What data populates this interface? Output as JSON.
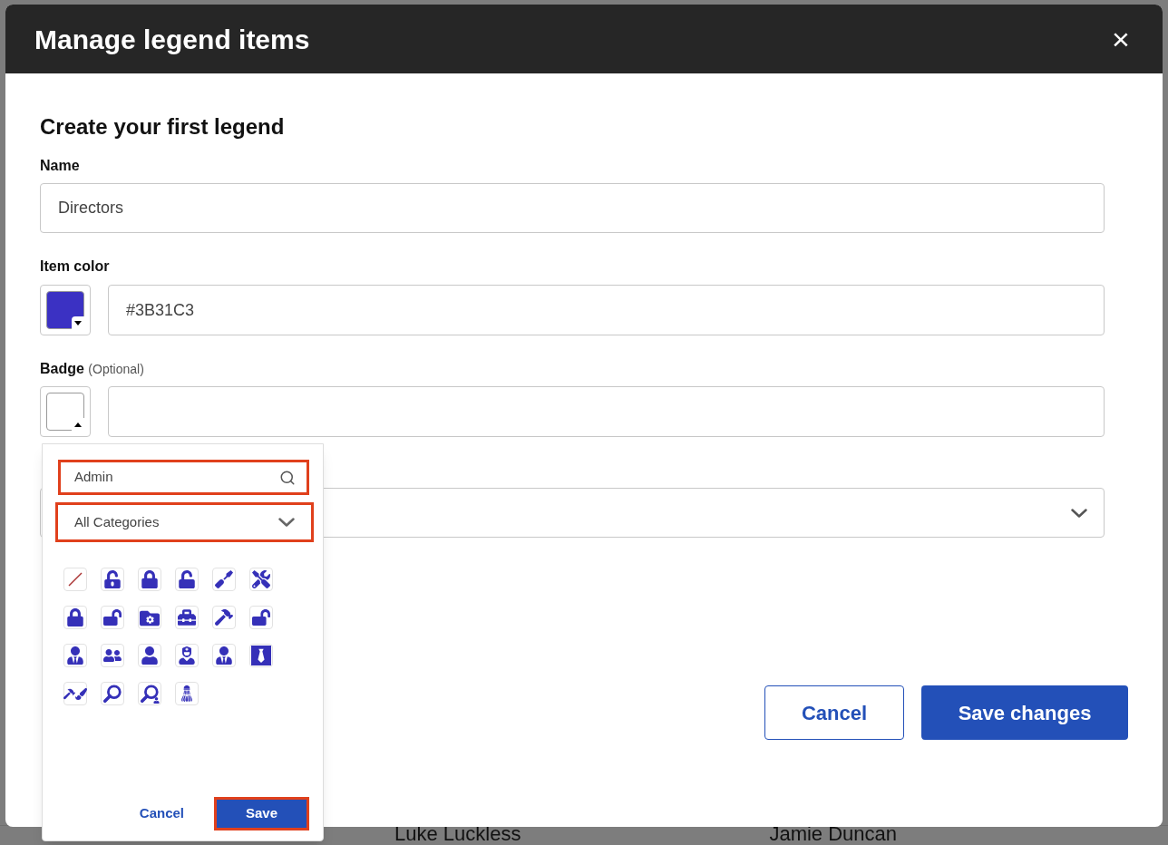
{
  "background": {
    "names": [
      "Luke Luckless",
      "Jamie Duncan"
    ]
  },
  "dialog": {
    "title": "Manage legend items",
    "close": "×"
  },
  "form": {
    "heading": "Create your first legend",
    "name": {
      "label": "Name",
      "value": "Directors"
    },
    "item_color": {
      "label": "Item color",
      "value": "#3B31C3",
      "picker_expanded": false
    },
    "badge": {
      "label": "Badge",
      "hint": "(Optional)",
      "picker_expanded": true
    }
  },
  "badge_picker": {
    "search": {
      "value": "Admin"
    },
    "category": {
      "value": "All Categories"
    },
    "cancel": "Cancel",
    "save": "Save"
  },
  "buttons": {
    "cancel": "Cancel",
    "save": "Save changes"
  }
}
